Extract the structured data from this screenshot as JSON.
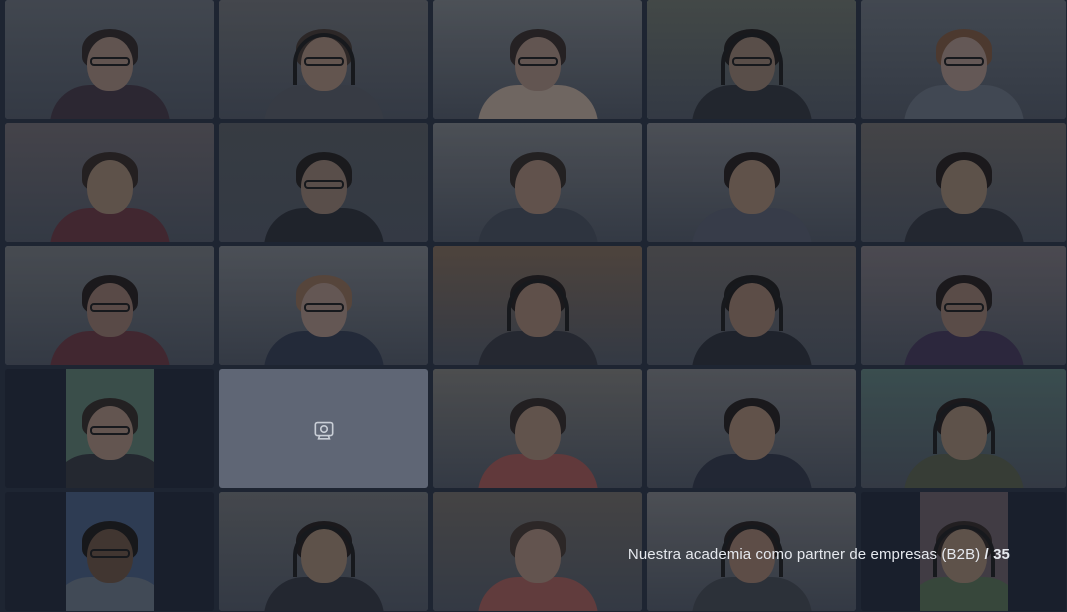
{
  "meeting": {
    "participants": [
      {
        "id": "p1",
        "bg": "#5a5f66",
        "skin": "#8a7468",
        "hair": "#2a2321",
        "shirt": "#3a2e3a",
        "glasses": true,
        "headset": false,
        "state": "video"
      },
      {
        "id": "p2",
        "bg": "#5e6063",
        "skin": "#8e7566",
        "hair": "#3a2f28",
        "shirt": "#4a4e55",
        "glasses": true,
        "headset": true,
        "state": "video"
      },
      {
        "id": "p3",
        "bg": "#6b6f72",
        "skin": "#8d7569",
        "hair": "#2e2522",
        "shirt": "#a08f82",
        "glasses": true,
        "headset": false,
        "state": "video"
      },
      {
        "id": "p4",
        "bg": "#5c6259",
        "skin": "#7f6a5d",
        "hair": "#1d1a18",
        "shirt": "#2a2d33",
        "glasses": true,
        "headset": true,
        "state": "active"
      },
      {
        "id": "p5",
        "bg": "#5b6168",
        "skin": "#8f7a70",
        "hair": "#6b4a35",
        "shirt": "#5a616c",
        "glasses": true,
        "headset": false,
        "state": "video"
      },
      {
        "id": "p6",
        "bg": "#5f5a5e",
        "skin": "#86705f",
        "hair": "#2d2420",
        "shirt": "#5a2e36",
        "glasses": false,
        "headset": false,
        "state": "video"
      },
      {
        "id": "p7",
        "bg": "#4a4e52",
        "skin": "#7e6a5e",
        "hair": "#1e1b1a",
        "shirt": "#25282f",
        "glasses": true,
        "headset": false,
        "state": "video"
      },
      {
        "id": "p8",
        "bg": "#6a6d70",
        "skin": "#8a7062",
        "hair": "#2c2521",
        "shirt": "#3d434d",
        "glasses": false,
        "headset": false,
        "state": "video"
      },
      {
        "id": "p9",
        "bg": "#6a6c70",
        "skin": "#89705f",
        "hair": "#1f1a18",
        "shirt": "#4a4f5c",
        "glasses": false,
        "headset": false,
        "state": "video"
      },
      {
        "id": "p10",
        "bg": "#5e5b59",
        "skin": "#84705f",
        "hair": "#1f1a18",
        "shirt": "#2b2e36",
        "glasses": false,
        "headset": false,
        "state": "video"
      },
      {
        "id": "p11",
        "bg": "#636669",
        "skin": "#7f6559",
        "hair": "#1f1a18",
        "shirt": "#5a2f36",
        "glasses": true,
        "headset": false,
        "state": "video"
      },
      {
        "id": "p12",
        "bg": "#6a6d71",
        "skin": "#90796d",
        "hair": "#7a5c48",
        "shirt": "#2b3344",
        "glasses": true,
        "headset": false,
        "state": "video"
      },
      {
        "id": "p13",
        "bg": "#6d5a4a",
        "skin": "#876d5e",
        "hair": "#1f1a18",
        "shirt": "#2e3138",
        "glasses": false,
        "headset": true,
        "state": "video"
      },
      {
        "id": "p14",
        "bg": "#5e5a58",
        "skin": "#83695a",
        "hair": "#1a1716",
        "shirt": "#262930",
        "glasses": false,
        "headset": true,
        "state": "video"
      },
      {
        "id": "p15",
        "bg": "#6a6468",
        "skin": "#80685b",
        "hair": "#1f1a18",
        "shirt": "#3a2f4a",
        "glasses": true,
        "headset": false,
        "state": "video"
      },
      {
        "id": "p16",
        "bg": "#4f6a5e",
        "skin": "#8e7668",
        "hair": "#2c2521",
        "shirt": "#2d3036",
        "glasses": true,
        "headset": false,
        "state": "narrow"
      },
      {
        "id": "p17",
        "bg": "#5f6675",
        "skin": "#000000",
        "hair": "#000000",
        "shirt": "#000000",
        "glasses": false,
        "headset": false,
        "state": "nocam"
      },
      {
        "id": "p18",
        "bg": "#6b6a66",
        "skin": "#8a7262",
        "hair": "#2a2220",
        "shirt": "#8a4b47",
        "glasses": false,
        "headset": false,
        "state": "video"
      },
      {
        "id": "p19",
        "bg": "#6a6b6d",
        "skin": "#8a705f",
        "hair": "#1e1a18",
        "shirt": "#2a2f3c",
        "glasses": false,
        "headset": false,
        "state": "video"
      },
      {
        "id": "p20",
        "bg": "#4f6a66",
        "skin": "#86705f",
        "hair": "#1f1a18",
        "shirt": "#4a5040",
        "glasses": false,
        "headset": true,
        "state": "video"
      },
      {
        "id": "p21",
        "bg": "#3d4f6c",
        "skin": "#5a4638",
        "hair": "#1a1716",
        "shirt": "#5a6470",
        "glasses": true,
        "headset": false,
        "state": "narrow"
      },
      {
        "id": "p22",
        "bg": "#5f6163",
        "skin": "#86705f",
        "hair": "#1f1a18",
        "shirt": "#2b2e36",
        "glasses": false,
        "headset": true,
        "state": "video"
      },
      {
        "id": "p23",
        "bg": "#5f5a55",
        "skin": "#8e7466",
        "hair": "#3a2f28",
        "shirt": "#8a4f4a",
        "glasses": false,
        "headset": false,
        "state": "video"
      },
      {
        "id": "p24",
        "bg": "#6b6c6e",
        "skin": "#84695a",
        "hair": "#1f1a18",
        "shirt": "#3a3e44",
        "glasses": false,
        "headset": true,
        "state": "video"
      },
      {
        "id": "p25",
        "bg": "#5a4f55",
        "skin": "#86705f",
        "hair": "#2a2220",
        "shirt": "#4a6048",
        "glasses": false,
        "headset": true,
        "state": "narrow"
      }
    ]
  },
  "slide": {
    "title": "Nuestra academia como partner de empresas (B2B)",
    "separator": "/",
    "page": "35"
  },
  "icons": {
    "no_camera": "camera-off-icon"
  },
  "colors": {
    "background": "#1e2532",
    "active_border": "#5a7a5e",
    "label": "#e6e9ef"
  }
}
